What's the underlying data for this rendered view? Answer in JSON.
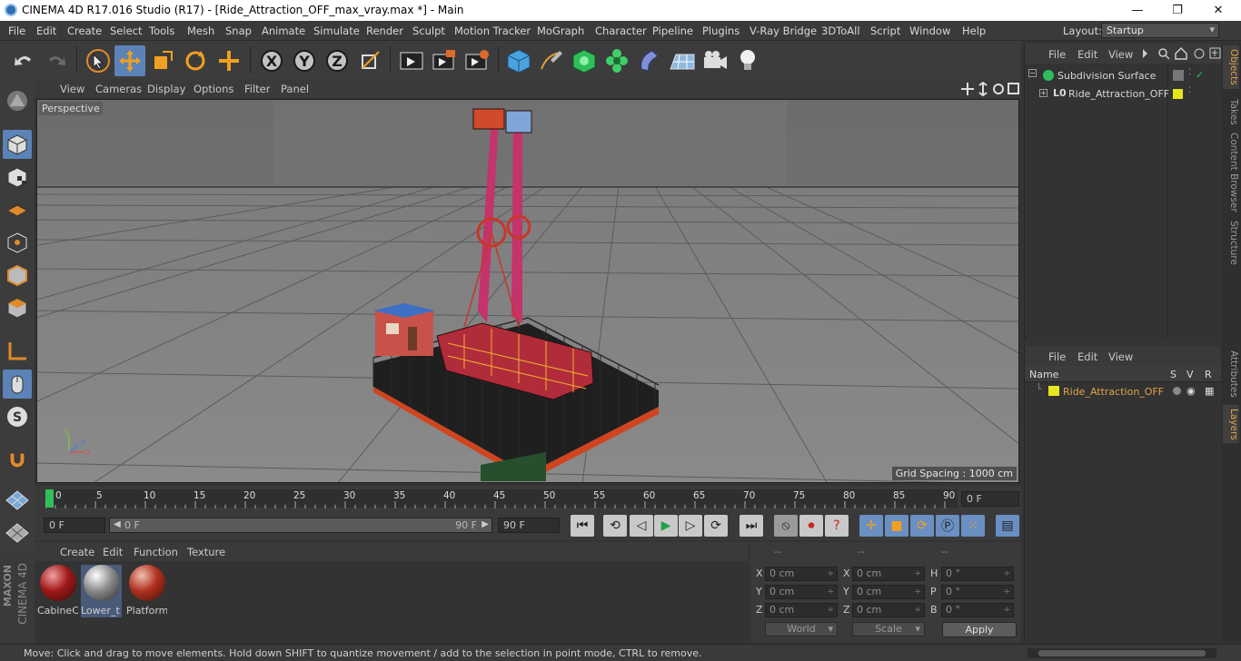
{
  "window": {
    "title": "CINEMA 4D R17.016 Studio (R17) - [Ride_Attraction_OFF_max_vray.max *] - Main",
    "minimize": "—",
    "restore": "❐",
    "close": "✕"
  },
  "menubar": {
    "items": [
      "File",
      "Edit",
      "Create",
      "Select",
      "Tools",
      "Mesh",
      "Snap",
      "Animate",
      "Simulate",
      "Render",
      "Sculpt",
      "Motion Tracker",
      "MoGraph",
      "Character",
      "Pipeline",
      "Plugins",
      "V-Ray Bridge",
      "3DToAll",
      "Script",
      "Window",
      "Help"
    ],
    "layout_label": "Layout:",
    "layout_value": "Startup"
  },
  "toolbar": {
    "axis": [
      "X",
      "Y",
      "Z"
    ]
  },
  "viewport": {
    "menu": [
      "View",
      "Cameras",
      "Display",
      "Options",
      "Filter",
      "Panel"
    ],
    "label": "Perspective",
    "grid_spacing": "Grid Spacing : 1000 cm",
    "axis_x": "x",
    "axis_y": "y",
    "axis_z": "z"
  },
  "timeline": {
    "ticks": [
      "0",
      "5",
      "10",
      "15",
      "20",
      "25",
      "30",
      "35",
      "40",
      "45",
      "50",
      "55",
      "60",
      "65",
      "70",
      "75",
      "80",
      "85",
      "90"
    ],
    "current_frame": "0 F"
  },
  "playbar": {
    "start": "0 F",
    "range_start": "0 F",
    "range_end": "90 F",
    "end": "90 F"
  },
  "materials": {
    "menu": [
      "Create",
      "Edit",
      "Function",
      "Texture"
    ],
    "items": [
      "CabineC",
      "Lower_t",
      "Platform"
    ]
  },
  "coords": {
    "headers": [
      "--",
      "--",
      "--"
    ],
    "rows": [
      {
        "a": "X",
        "av": "0 cm",
        "b": "X",
        "bv": "0 cm",
        "c": "H",
        "cv": "0 °"
      },
      {
        "a": "Y",
        "av": "0 cm",
        "b": "Y",
        "bv": "0 cm",
        "c": "P",
        "cv": "0 °"
      },
      {
        "a": "Z",
        "av": "0 cm",
        "b": "Z",
        "bv": "0 cm",
        "c": "B",
        "cv": "0 °"
      }
    ],
    "world": "World",
    "scale": "Scale",
    "apply": "Apply"
  },
  "status": "Move: Click and drag to move elements. Hold down SHIFT to quantize movement / add to the selection in point mode, CTRL to remove.",
  "objects": {
    "menu": [
      "File",
      "Edit",
      "View"
    ],
    "items": [
      {
        "name": "Subdivision Surface"
      },
      {
        "name": "Ride_Attraction_OFF"
      }
    ]
  },
  "layers": {
    "menu": [
      "File",
      "Edit",
      "View"
    ],
    "col_name": "Name",
    "col_s": "S",
    "col_v": "V",
    "col_r": "R",
    "items": [
      {
        "name": "Ride_Attraction_OFF"
      }
    ]
  },
  "sidetabs": [
    "Objects",
    "Takes",
    "Content Browser",
    "Structure",
    "Attributes",
    "Layers"
  ],
  "logo": {
    "maxon": "MAXON",
    "cinema": "CINEMA 4D"
  },
  "colors": {
    "accent": "#5b83b8",
    "layer": "#e1a44a",
    "viewport": "#7e7e7e"
  }
}
